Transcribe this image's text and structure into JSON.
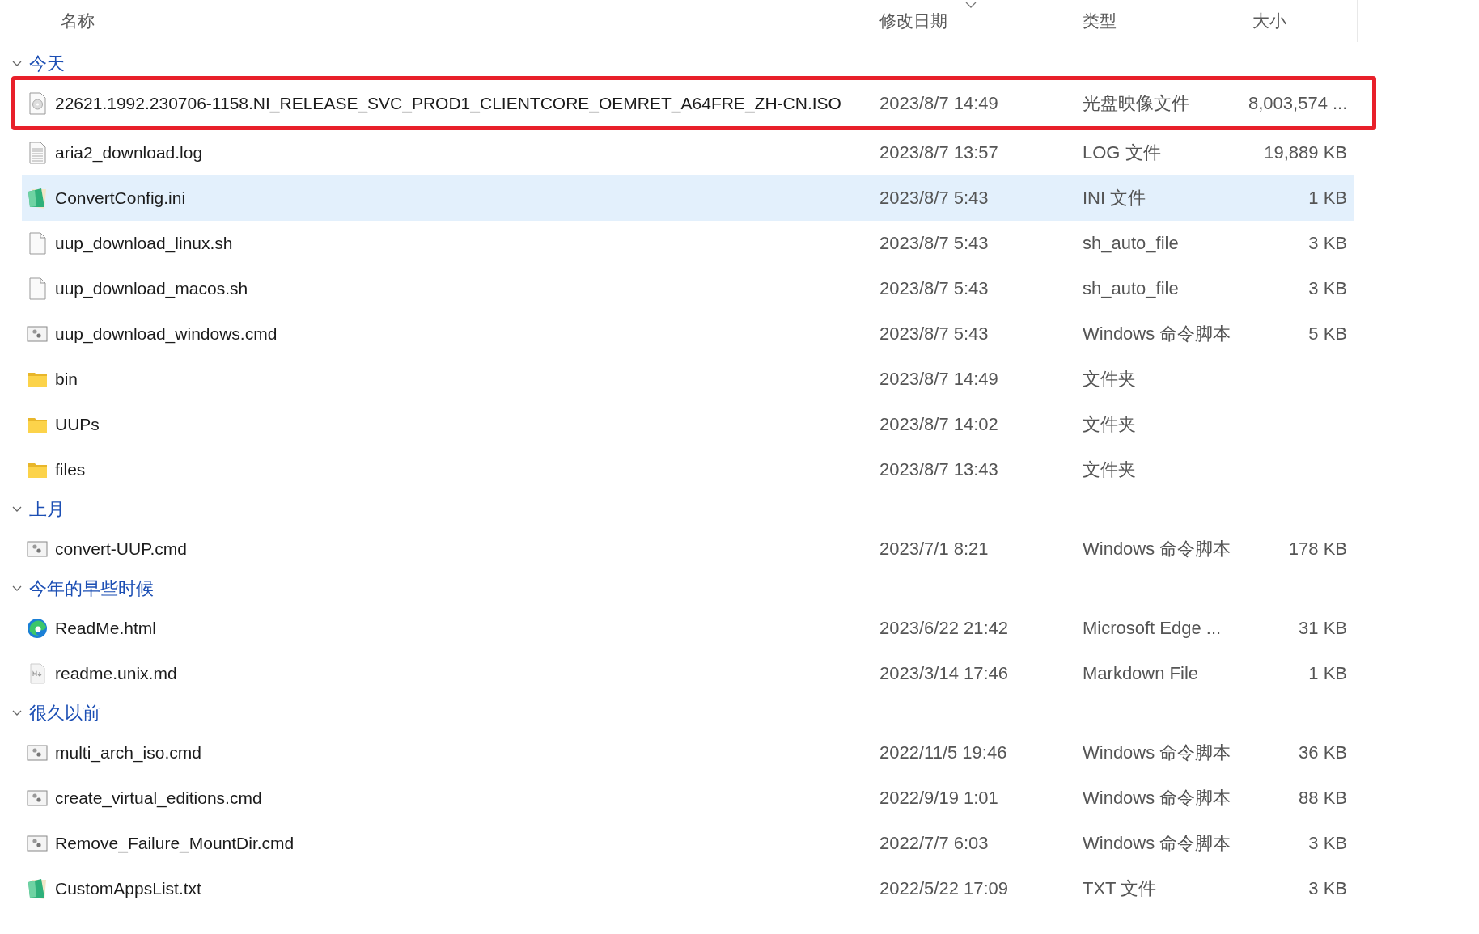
{
  "columns": [
    {
      "label": "名称",
      "sorted": false
    },
    {
      "label": "修改日期",
      "sorted": true
    },
    {
      "label": "类型",
      "sorted": false
    },
    {
      "label": "大小",
      "sorted": false
    }
  ],
  "groups": [
    {
      "label": "今天",
      "expanded": true,
      "rows": [
        {
          "kind": "disc",
          "name": "22621.1992.230706-1158.NI_RELEASE_SVC_PROD1_CLIENTCORE_OEMRET_A64FRE_ZH-CN.ISO",
          "date": "2023/8/7 14:49",
          "type": "光盘映像文件",
          "size": "8,003,574 ...",
          "selected": false,
          "highlighted": true
        },
        {
          "kind": "text",
          "name": "aria2_download.log",
          "date": "2023/8/7 13:57",
          "type": "LOG 文件",
          "size": "19,889 KB",
          "selected": false,
          "highlighted": false
        },
        {
          "kind": "notepad",
          "name": "ConvertConfig.ini",
          "date": "2023/8/7 5:43",
          "type": "INI 文件",
          "size": "1 KB",
          "selected": true,
          "highlighted": false
        },
        {
          "kind": "blank",
          "name": "uup_download_linux.sh",
          "date": "2023/8/7 5:43",
          "type": "sh_auto_file",
          "size": "3 KB",
          "selected": false,
          "highlighted": false
        },
        {
          "kind": "blank",
          "name": "uup_download_macos.sh",
          "date": "2023/8/7 5:43",
          "type": "sh_auto_file",
          "size": "3 KB",
          "selected": false,
          "highlighted": false
        },
        {
          "kind": "script",
          "name": "uup_download_windows.cmd",
          "date": "2023/8/7 5:43",
          "type": "Windows 命令脚本",
          "size": "5 KB",
          "selected": false,
          "highlighted": false
        },
        {
          "kind": "folder",
          "name": "bin",
          "date": "2023/8/7 14:49",
          "type": "文件夹",
          "selected": false,
          "highlighted": false
        },
        {
          "kind": "folder",
          "name": "UUPs",
          "date": "2023/8/7 14:02",
          "type": "文件夹",
          "selected": false,
          "highlighted": false
        },
        {
          "kind": "folder",
          "name": "files",
          "date": "2023/8/7 13:43",
          "type": "文件夹",
          "selected": false,
          "highlighted": false
        }
      ]
    },
    {
      "label": "上月",
      "expanded": true,
      "rows": [
        {
          "kind": "script",
          "name": "convert-UUP.cmd",
          "date": "2023/7/1 8:21",
          "type": "Windows 命令脚本",
          "size": "178 KB",
          "selected": false,
          "highlighted": false
        }
      ]
    },
    {
      "label": "今年的早些时候",
      "expanded": true,
      "rows": [
        {
          "kind": "edge",
          "name": "ReadMe.html",
          "date": "2023/6/22 21:42",
          "type": "Microsoft Edge ...",
          "size": "31 KB",
          "selected": false,
          "highlighted": false
        },
        {
          "kind": "markdown",
          "name": "readme.unix.md",
          "date": "2023/3/14 17:46",
          "type": "Markdown File",
          "size": "1 KB",
          "selected": false,
          "highlighted": false
        }
      ]
    },
    {
      "label": "很久以前",
      "expanded": true,
      "rows": [
        {
          "kind": "script",
          "name": "multi_arch_iso.cmd",
          "date": "2022/11/5 19:46",
          "type": "Windows 命令脚本",
          "size": "36 KB",
          "selected": false,
          "highlighted": false
        },
        {
          "kind": "script",
          "name": "create_virtual_editions.cmd",
          "date": "2022/9/19 1:01",
          "type": "Windows 命令脚本",
          "size": "88 KB",
          "selected": false,
          "highlighted": false
        },
        {
          "kind": "script",
          "name": "Remove_Failure_MountDir.cmd",
          "date": "2022/7/7 6:03",
          "type": "Windows 命令脚本",
          "size": "3 KB",
          "selected": false,
          "highlighted": false
        },
        {
          "kind": "notepad",
          "name": "CustomAppsList.txt",
          "date": "2022/5/22 17:09",
          "type": "TXT 文件",
          "size": "3 KB",
          "selected": false,
          "highlighted": false
        }
      ]
    }
  ]
}
